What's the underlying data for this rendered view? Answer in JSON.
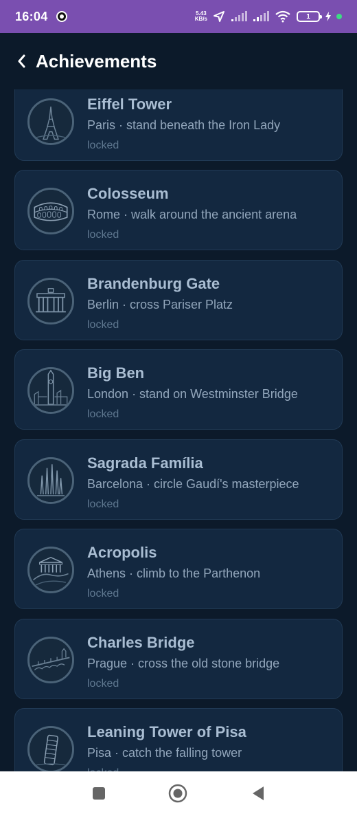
{
  "status_bar": {
    "time": "16:04",
    "net_speed_value": "5.43",
    "net_speed_unit": "KB/s",
    "battery": "1"
  },
  "header": {
    "title": "Achievements"
  },
  "achievements": [
    {
      "title": "Eiffel Tower",
      "subtitle": "Paris · stand beneath the Iron Lady",
      "status": "locked"
    },
    {
      "title": "Colosseum",
      "subtitle": "Rome · walk around the ancient arena",
      "status": "locked"
    },
    {
      "title": "Brandenburg Gate",
      "subtitle": "Berlin · cross Pariser Platz",
      "status": "locked"
    },
    {
      "title": "Big Ben",
      "subtitle": "London · stand on Westminster Bridge",
      "status": "locked"
    },
    {
      "title": "Sagrada Família",
      "subtitle": "Barcelona · circle Gaudí's masterpiece",
      "status": "locked"
    },
    {
      "title": "Acropolis",
      "subtitle": "Athens · climb to the Parthenon",
      "status": "locked"
    },
    {
      "title": "Charles Bridge",
      "subtitle": "Prague · cross the old stone bridge",
      "status": "locked"
    },
    {
      "title": "Leaning Tower of Pisa",
      "subtitle": "Pisa · catch the falling tower",
      "status": "locked"
    }
  ],
  "colors": {
    "status_bar": "#7a4fb0",
    "background": "#0c1a2a",
    "card": "#132840",
    "title_text": "#a9bdd2"
  }
}
